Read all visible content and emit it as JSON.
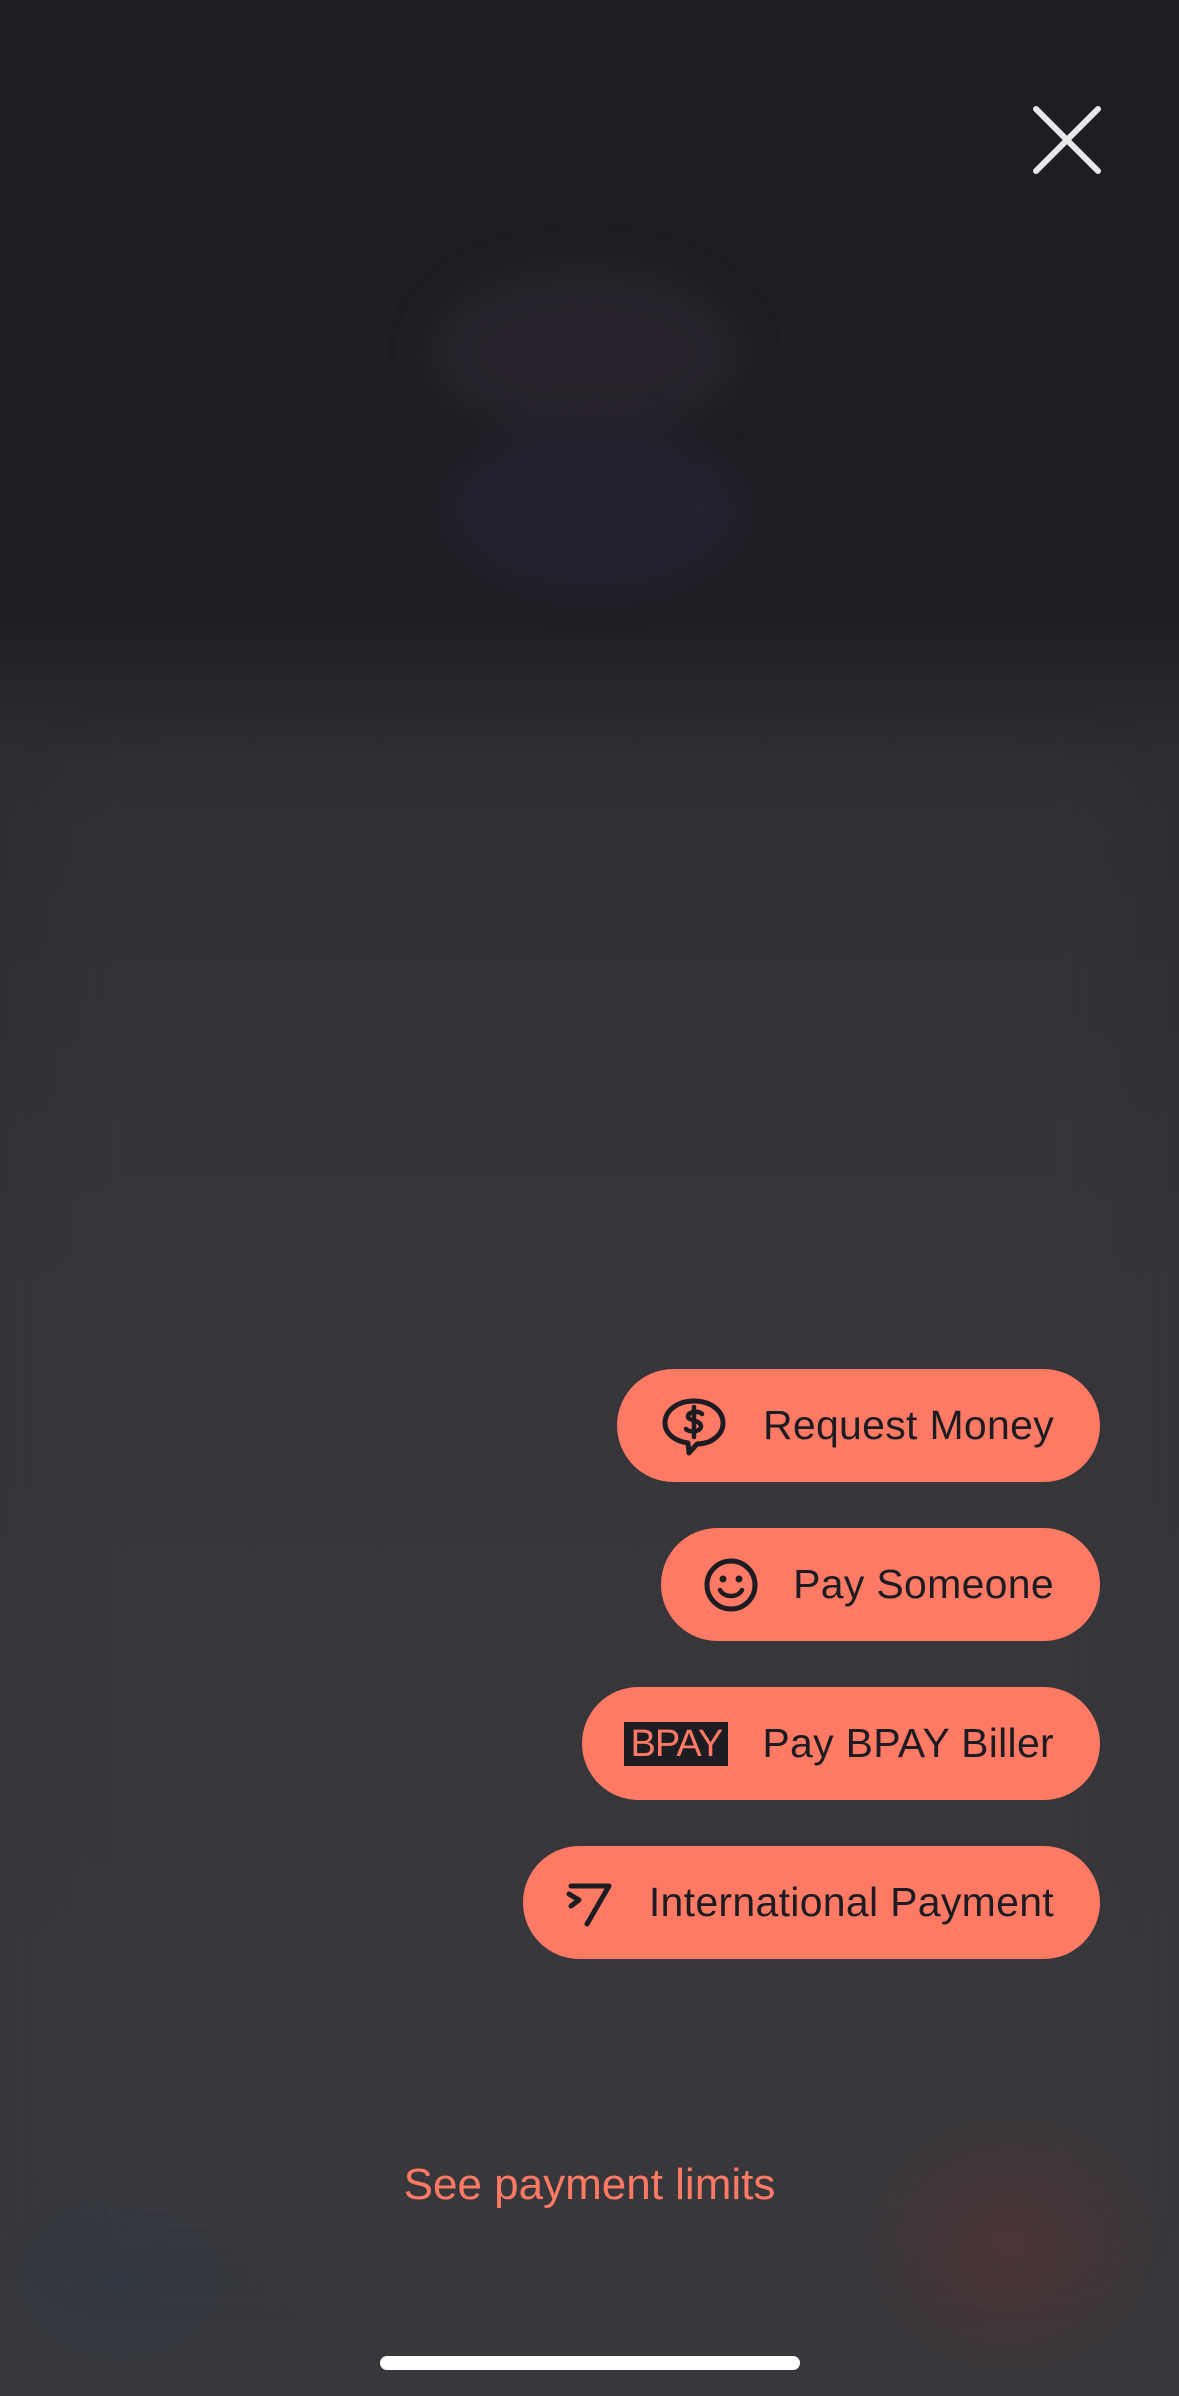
{
  "header": {
    "close_icon": "close-icon"
  },
  "actions": [
    {
      "label": "Request Money",
      "icon": "money-speech-bubble-icon"
    },
    {
      "label": "Pay Someone",
      "icon": "smiley-icon"
    },
    {
      "label": "Pay BPAY Biller",
      "icon": "bpay-logo-icon",
      "logo_text": "BPAY"
    },
    {
      "label": "International Payment",
      "icon": "wise-logo-icon"
    }
  ],
  "footer": {
    "limits_label": "See payment limits"
  },
  "colors": {
    "accent": "#ff7a64",
    "button_text": "#1d1c22",
    "background": "#2a292d"
  }
}
